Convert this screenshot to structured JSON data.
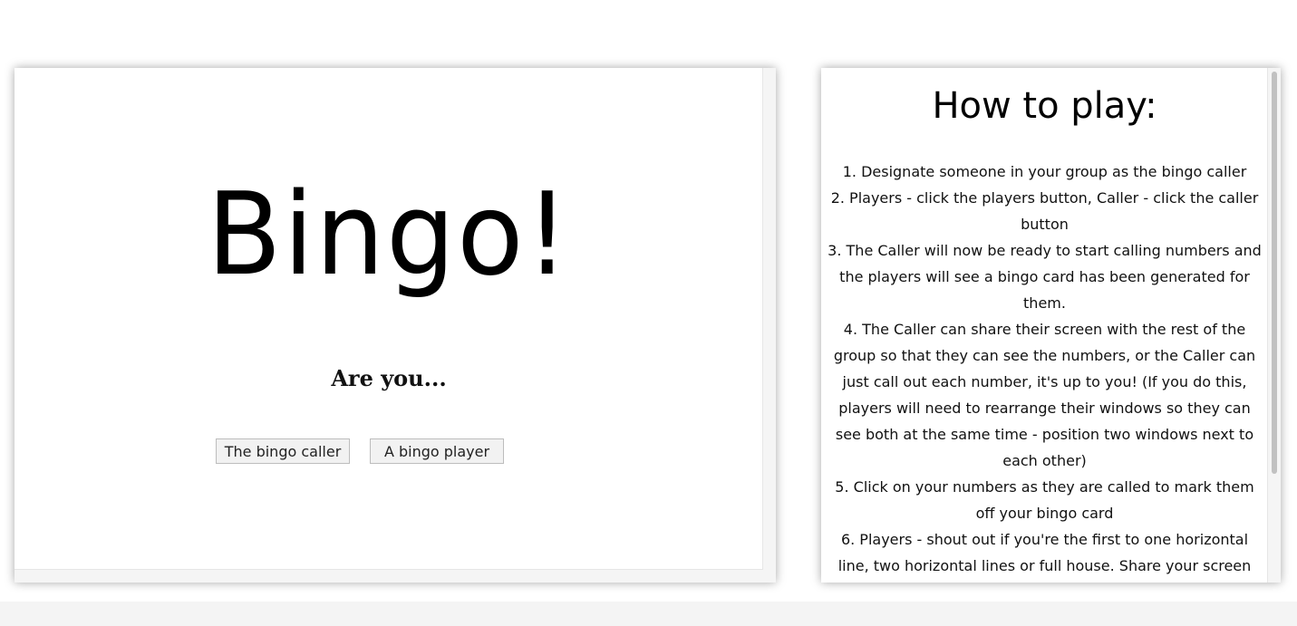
{
  "main": {
    "title": "Bingo!",
    "prompt": "Are you...",
    "buttons": {
      "caller_label": "The bingo caller",
      "player_label": "A bingo player"
    }
  },
  "instructions": {
    "title": "How to play:",
    "steps": [
      "1. Designate someone in your group as the bingo caller",
      "2. Players - click the players button, Caller - click the caller button",
      "3. The Caller will now be ready to start calling numbers and the players will see a bingo card has been generated for them.",
      "4. The Caller can share their screen with the rest of the group so that they can see the numbers, or the Caller can just call out each number, it's up to you! (If you do this, players will need to rearrange their windows so they can see both at the same time - position two windows next to each other)",
      "5. Click on your numbers as they are called to mark them off your bingo card",
      "6. Players - shout out if you're the first to one horizontal line, two horizontal lines or full house. Share your screen"
    ]
  }
}
